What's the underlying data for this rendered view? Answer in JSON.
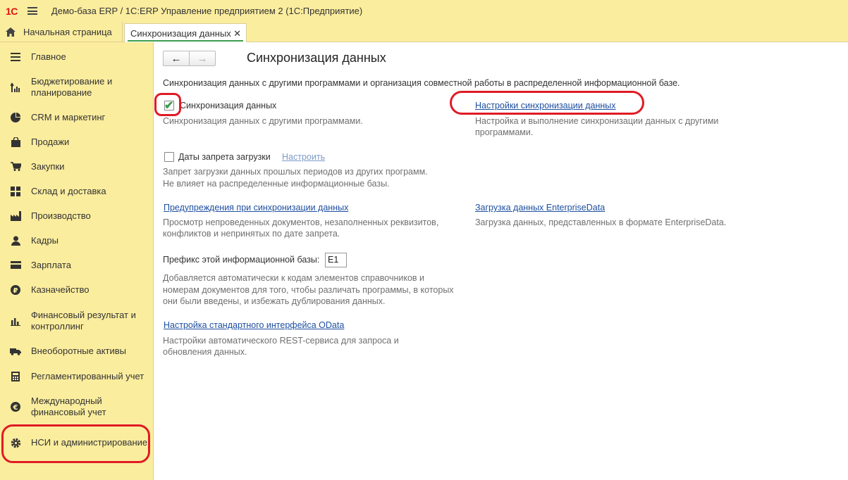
{
  "app": {
    "logo": "1С",
    "title": "Демо-база ERP / 1С:ERP Управление предприятием 2  (1С:Предприятие)"
  },
  "tabs": {
    "home": "Начальная страница",
    "active": "Синхронизация данных"
  },
  "sidebar": {
    "items": [
      {
        "label": "Главное",
        "icon": "menu-icon"
      },
      {
        "label": "Бюджетирование и планирование",
        "icon": "budget-icon"
      },
      {
        "label": "CRM и маркетинг",
        "icon": "pie-icon"
      },
      {
        "label": "Продажи",
        "icon": "bag-icon"
      },
      {
        "label": "Закупки",
        "icon": "cart-icon"
      },
      {
        "label": "Склад и доставка",
        "icon": "warehouse-icon"
      },
      {
        "label": "Производство",
        "icon": "factory-icon"
      },
      {
        "label": "Кадры",
        "icon": "person-icon"
      },
      {
        "label": "Зарплата",
        "icon": "wallet-icon"
      },
      {
        "label": "Казначейство",
        "icon": "ruble-icon"
      },
      {
        "label": "Финансовый результат и контроллинг",
        "icon": "bar-chart-icon"
      },
      {
        "label": "Внеоборотные активы",
        "icon": "truck-icon"
      },
      {
        "label": "Регламентированный учет",
        "icon": "calculator-icon"
      },
      {
        "label": "Международный финансовый учет",
        "icon": "euro-icon"
      },
      {
        "label": "НСИ и администрирование",
        "icon": "gear-icon"
      }
    ]
  },
  "page": {
    "title": "Синхронизация данных",
    "description": "Синхронизация данных с другими программами и организация совместной работы в распределенной информационной базе.",
    "sync": {
      "label": "Синхронизация данных",
      "hint": "Синхронизация данных с другими программами.",
      "checked": true
    },
    "settings_link": {
      "label": "Настройки синхронизации данных",
      "hint_line1": "Настройка и выполнение синхронизации данных с другими",
      "hint_line2": "программами."
    },
    "ban_dates": {
      "label": "Даты запрета загрузки",
      "configure": "Настроить",
      "hint_line1": "Запрет загрузки данных прошлых периодов из других программ.",
      "hint_line2": "Не влияет на распределенные информационные базы.",
      "checked": false
    },
    "warnings_link": {
      "label": "Предупреждения при синхронизации данных",
      "hint_line1": "Просмотр непроведенных документов, незаполненных реквизитов,",
      "hint_line2": "конфликтов и непринятых по дате запрета."
    },
    "enterprise_link": {
      "label": "Загрузка данных EnterpriseData",
      "hint": "Загрузка данных, представленных в формате EnterpriseData."
    },
    "prefix": {
      "label": "Префикс этой информационной базы:",
      "value": "E1",
      "hint_line1": "Добавляется автоматически к кодам элементов справочников и",
      "hint_line2": "номерам документов для того, чтобы различать программы, в которых",
      "hint_line3": "они были введены, и избежать дублирования данных."
    },
    "odata_link": {
      "label": "Настройка стандартного интерфейса OData",
      "hint_line1": "Настройки автоматического REST-сервиса для запроса и",
      "hint_line2": "обновления данных."
    }
  },
  "colors": {
    "panel": "#fbed9e",
    "link": "#1e4fa0",
    "highlight": "#e01b24",
    "accent": "#3c9d4e"
  }
}
